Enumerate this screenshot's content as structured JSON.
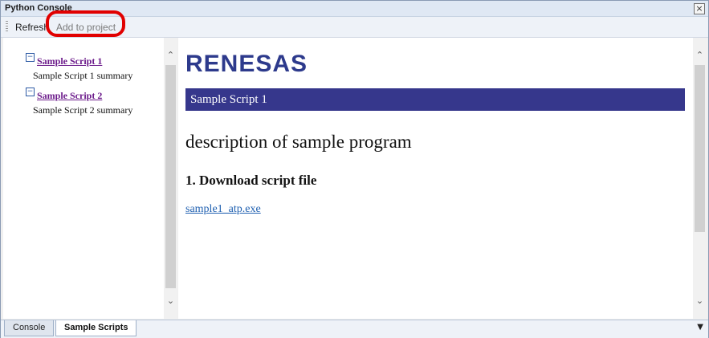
{
  "window": {
    "title": "Python Console"
  },
  "toolbar": {
    "refresh_label": "Refresh",
    "add_label": "Add to project"
  },
  "tree": {
    "items": [
      {
        "title": "Sample Script 1",
        "summary": "Sample Script 1 summary"
      },
      {
        "title": "Sample Script 2",
        "summary": "Sample Script 2 summary"
      }
    ]
  },
  "content": {
    "logo_text": "RENESAS",
    "section_title": "Sample Script 1",
    "description": "description of sample program",
    "heading": "1. Download script file",
    "link": "sample1_atp.exe"
  },
  "tabs": {
    "console": "Console",
    "sample_scripts": "Sample Scripts"
  },
  "icons": {
    "close": "close-icon",
    "collapse": "minus-icon",
    "scroll_up": "chevron-up-icon",
    "scroll_down": "chevron-down-icon",
    "dropdown": "chevron-down-icon"
  },
  "colors": {
    "section_bar": "#36378c",
    "logo": "#2d3a8c",
    "highlight": "#e10000"
  }
}
